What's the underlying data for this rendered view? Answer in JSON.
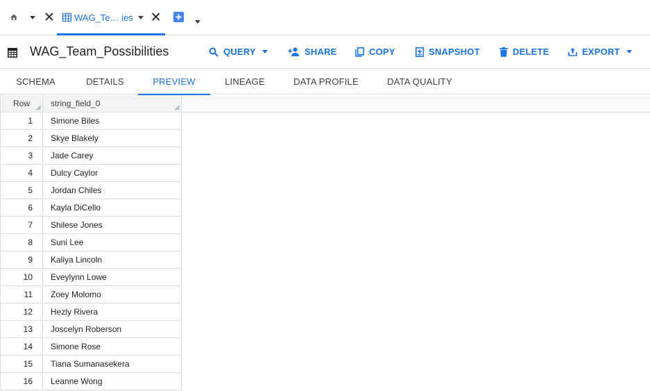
{
  "tabs": {
    "active_title": "WAG_Te… ies"
  },
  "title": "WAG_Team_Possibilities",
  "actions": {
    "query": "QUERY",
    "share": "SHARE",
    "copy": "COPY",
    "snapshot": "SNAPSHOT",
    "delete": "DELETE",
    "export": "EXPORT"
  },
  "subtabs": {
    "schema": "SCHEMA",
    "details": "DETAILS",
    "preview": "PREVIEW",
    "lineage": "LINEAGE",
    "data_profile": "DATA PROFILE",
    "data_quality": "DATA QUALITY"
  },
  "table": {
    "columns": [
      "Row",
      "string_field_0"
    ],
    "rows": [
      {
        "n": "1",
        "v": "Simone Biles"
      },
      {
        "n": "2",
        "v": "Skye Blakely"
      },
      {
        "n": "3",
        "v": "Jade Carey"
      },
      {
        "n": "4",
        "v": "Dulcy Caylor"
      },
      {
        "n": "5",
        "v": "Jordan Chiles"
      },
      {
        "n": "6",
        "v": "Kayla DiCello"
      },
      {
        "n": "7",
        "v": "Shilese Jones"
      },
      {
        "n": "8",
        "v": "Suni Lee"
      },
      {
        "n": "9",
        "v": "Kaliya Lincoln"
      },
      {
        "n": "10",
        "v": "Eveylynn Lowe"
      },
      {
        "n": "11",
        "v": "Zoey Molomo"
      },
      {
        "n": "12",
        "v": "Hezly Rivera"
      },
      {
        "n": "13",
        "v": "Joscelyn Roberson"
      },
      {
        "n": "14",
        "v": "Simone Rose"
      },
      {
        "n": "15",
        "v": "Tiana Sumanasekera"
      },
      {
        "n": "16",
        "v": "Leanne Wong"
      }
    ]
  },
  "colors": {
    "accent": "#1a73e8",
    "border": "#dadce0",
    "text": "#202124"
  },
  "icons": [
    "home-icon",
    "table-icon",
    "close-icon",
    "add-tab-icon",
    "search-icon",
    "person-add-icon",
    "copy-icon",
    "snapshot-icon",
    "delete-icon",
    "export-icon"
  ]
}
